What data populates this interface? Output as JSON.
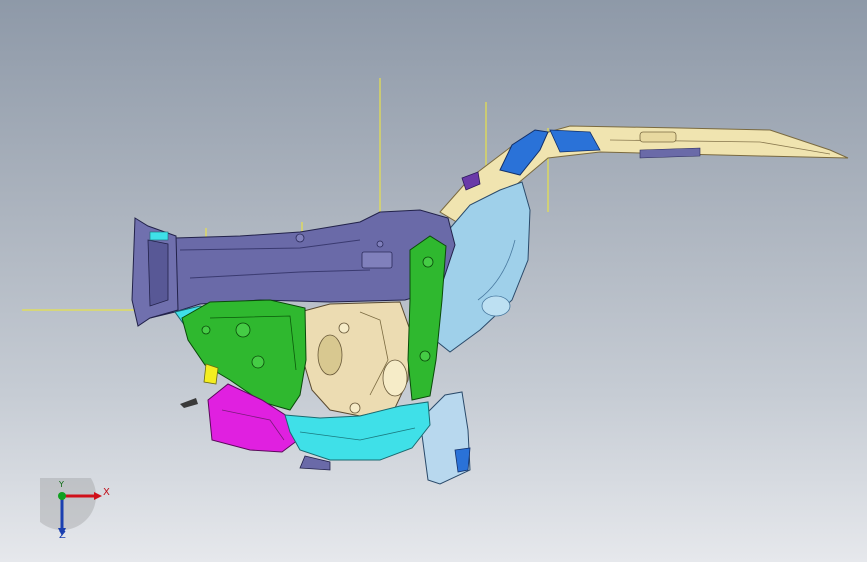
{
  "viewport": {
    "background_top": "#8e99a8",
    "background_bottom": "#e6e8ec"
  },
  "triad": {
    "x_label": "X",
    "y_label": "Y",
    "z_label": "Z",
    "x_color": "#d0101a",
    "y_color": "#10a020",
    "z_color": "#1a3fb0"
  },
  "model": {
    "colors": {
      "slate": "#6a6aa8",
      "green": "#2fb82f",
      "cyan": "#3fe0e8",
      "magenta": "#e020e0",
      "cream": "#f0e4b0",
      "blue": "#2a72d8",
      "lightblue": "#9fd0ea",
      "yellow": "#f4ee20"
    }
  }
}
